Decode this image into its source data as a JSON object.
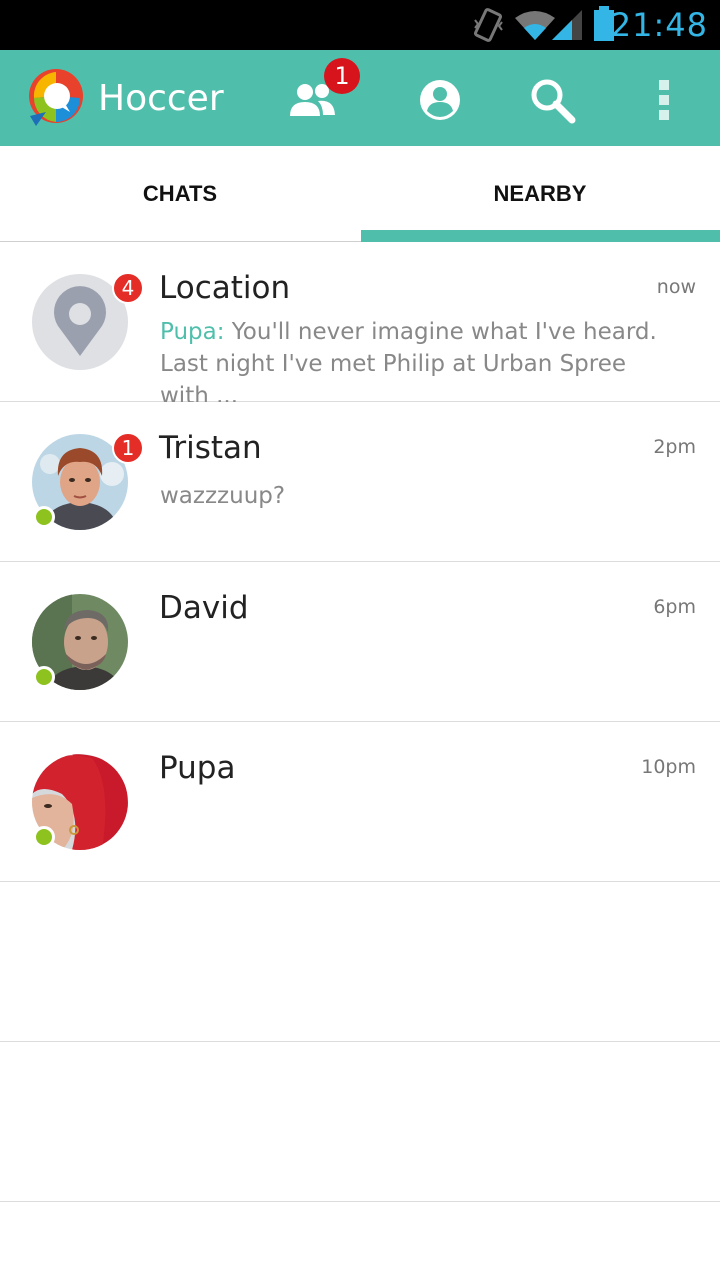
{
  "status_bar": {
    "time": "21:48",
    "icons": [
      "vibrate-icon",
      "wifi-icon",
      "signal-icon",
      "battery-icon"
    ]
  },
  "app_bar": {
    "title": "Hoccer",
    "contacts_badge": "1",
    "icons": [
      "hoccer-logo",
      "contacts-icon",
      "profile-icon",
      "search-icon",
      "overflow-menu-icon"
    ]
  },
  "tabs": [
    {
      "label": "CHATS",
      "selected": false
    },
    {
      "label": "NEARBY",
      "selected": true
    }
  ],
  "chats": [
    {
      "name": "Location",
      "time": "now",
      "badge": "4",
      "sender": "Pupa:",
      "preview": " You'll never imagine what I've heard. Last night I've met Philip at Urban Spree with ...",
      "online": false
    },
    {
      "name": "Tristan",
      "time": "2pm",
      "badge": "1",
      "sender": "",
      "preview": "wazzzuup?",
      "online": true
    },
    {
      "name": "David",
      "time": "6pm",
      "badge": "",
      "sender": "",
      "preview": "",
      "online": true
    },
    {
      "name": "Pupa",
      "time": "10pm",
      "badge": "",
      "sender": "",
      "preview": "",
      "online": true
    }
  ],
  "colors": {
    "accent": "#4fbfac",
    "badge": "#e52d27",
    "presence": "#8dc21f",
    "status_time": "#33b5e5"
  }
}
